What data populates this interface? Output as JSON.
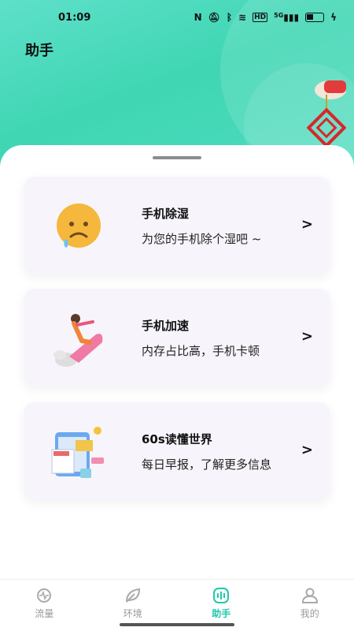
{
  "status_bar": {
    "time": "01:09",
    "icons": [
      "nfc-icon",
      "mute-icon",
      "bluetooth-icon",
      "wifi-icon",
      "hd-icon",
      "signal-icon",
      "battery-icon",
      "charging-icon"
    ],
    "network": "5G"
  },
  "header": {
    "title": "助手",
    "accent_color": "#3fd6b3"
  },
  "cards": [
    {
      "title": "手机除湿",
      "desc": "为您的手机除个湿吧 ~",
      "icon": "sad-face-icon"
    },
    {
      "title": "手机加速",
      "desc": "内存占比高，手机卡顿",
      "icon": "rocket-rider-icon"
    },
    {
      "title": "60s读懂世界",
      "desc": "每日早报，了解更多信息",
      "icon": "news-icon"
    }
  ],
  "tabbar": {
    "active_color": "#1fc9a8",
    "items": [
      {
        "label": "流量",
        "icon": "traffic-icon",
        "active": false
      },
      {
        "label": "环境",
        "icon": "leaf-icon",
        "active": false
      },
      {
        "label": "助手",
        "icon": "assistant-icon",
        "active": true
      },
      {
        "label": "我的",
        "icon": "user-icon",
        "active": false
      }
    ]
  }
}
